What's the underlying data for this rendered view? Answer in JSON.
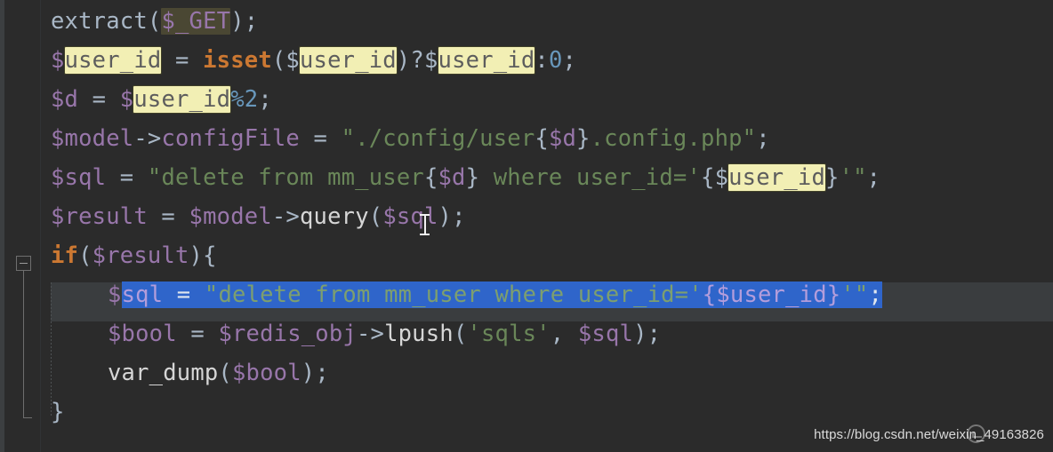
{
  "editor": {
    "background_color": "#2b2b2b",
    "gutter_color": "#3c3f41",
    "selection_color": "#2f65ca",
    "usage_highlight_color": "#f2efb4",
    "identifier_highlight_color": "#4a4733",
    "current_line_color": "#3a3d3f",
    "language": "PHP"
  },
  "code": {
    "lines": [
      {
        "index": 1,
        "text": "extract($_GET);",
        "tokens": [
          {
            "t": "extract",
            "k": "ident"
          },
          {
            "t": "(",
            "k": "punc"
          },
          {
            "t": "$_GET",
            "k": "var",
            "hl": "ident"
          },
          {
            "t": ")",
            "k": "punc"
          },
          {
            "t": ";",
            "k": "punc"
          }
        ]
      },
      {
        "index": 2,
        "text": "$user_id = isset($user_id)?$user_id:0;",
        "tokens": [
          {
            "t": "$",
            "k": "var"
          },
          {
            "t": "user_id",
            "k": "var",
            "hl": "write"
          },
          {
            "t": " = ",
            "k": "op"
          },
          {
            "t": "isset",
            "k": "kw"
          },
          {
            "t": "($",
            "k": "punc"
          },
          {
            "t": "user_id",
            "k": "var",
            "hl": "write"
          },
          {
            "t": ")?$",
            "k": "punc"
          },
          {
            "t": "user_id",
            "k": "var",
            "hl": "write"
          },
          {
            "t": ":",
            "k": "punc"
          },
          {
            "t": "0",
            "k": "num"
          },
          {
            "t": ";",
            "k": "punc"
          }
        ]
      },
      {
        "index": 3,
        "text": "$d = $user_id%2;",
        "tokens": [
          {
            "t": "$d",
            "k": "var"
          },
          {
            "t": " = ",
            "k": "op"
          },
          {
            "t": "$",
            "k": "var"
          },
          {
            "t": "user_id",
            "k": "var",
            "hl": "write"
          },
          {
            "t": "%",
            "k": "num"
          },
          {
            "t": "2",
            "k": "num"
          },
          {
            "t": ";",
            "k": "punc"
          }
        ]
      },
      {
        "index": 4,
        "text": "$model->configFile = \"./config/user{$d}.config.php\";",
        "tokens": [
          {
            "t": "$model",
            "k": "var"
          },
          {
            "t": "->",
            "k": "op"
          },
          {
            "t": "configFile",
            "k": "var"
          },
          {
            "t": " = ",
            "k": "op"
          },
          {
            "t": "\"./config/user",
            "k": "str"
          },
          {
            "t": "{",
            "k": "brace"
          },
          {
            "t": "$d",
            "k": "var"
          },
          {
            "t": "}",
            "k": "brace"
          },
          {
            "t": ".config.php\"",
            "k": "str"
          },
          {
            "t": ";",
            "k": "punc"
          }
        ]
      },
      {
        "index": 5,
        "text": "$sql = \"delete from mm_user{$d} where user_id='{$user_id}'\";",
        "tokens": [
          {
            "t": "$sql",
            "k": "var"
          },
          {
            "t": " = ",
            "k": "op"
          },
          {
            "t": "\"delete from mm_user",
            "k": "str"
          },
          {
            "t": "{",
            "k": "brace"
          },
          {
            "t": "$d",
            "k": "var"
          },
          {
            "t": "}",
            "k": "brace"
          },
          {
            "t": " where user_id='",
            "k": "str"
          },
          {
            "t": "{$",
            "k": "brace"
          },
          {
            "t": "user_id",
            "k": "var",
            "hl": "write"
          },
          {
            "t": "}",
            "k": "brace"
          },
          {
            "t": "'\"",
            "k": "str"
          },
          {
            "t": ";",
            "k": "punc"
          }
        ]
      },
      {
        "index": 6,
        "text": "$result = $model->query($sql);",
        "tokens": [
          {
            "t": "$result",
            "k": "var"
          },
          {
            "t": " = ",
            "k": "op"
          },
          {
            "t": "$model",
            "k": "var"
          },
          {
            "t": "->",
            "k": "op"
          },
          {
            "t": "query",
            "k": "fn"
          },
          {
            "t": "(",
            "k": "punc"
          },
          {
            "t": "$sql",
            "k": "var"
          },
          {
            "t": ")",
            "k": "punc"
          },
          {
            "t": ";",
            "k": "punc"
          }
        ]
      },
      {
        "index": 7,
        "text": "if($result){",
        "tokens": [
          {
            "t": "if",
            "k": "kw"
          },
          {
            "t": "(",
            "k": "punc"
          },
          {
            "t": "$result",
            "k": "var"
          },
          {
            "t": ")",
            "k": "punc"
          },
          {
            "t": "{",
            "k": "brace"
          }
        ]
      },
      {
        "index": 8,
        "text": "    $sql = \"delete from mm_user where user_id='{$user_id}'\";",
        "selected": true,
        "tokens": [
          {
            "t": "$",
            "k": "var"
          },
          {
            "t": "sql",
            "k": "var",
            "sel": true
          },
          {
            "t": " = ",
            "k": "op",
            "sel": true
          },
          {
            "t": "\"delete from mm_user where user_id='",
            "k": "str",
            "sel": true
          },
          {
            "t": "{$user_id}",
            "k": "var",
            "sel": true
          },
          {
            "t": "'\"",
            "k": "str",
            "sel": true
          },
          {
            "t": ";",
            "k": "punc",
            "sel": true
          }
        ]
      },
      {
        "index": 9,
        "text": "    $bool = $redis_obj->lpush('sqls', $sql);",
        "tokens": [
          {
            "t": "$bool",
            "k": "var"
          },
          {
            "t": " = ",
            "k": "op"
          },
          {
            "t": "$redis_obj",
            "k": "var"
          },
          {
            "t": "->",
            "k": "op"
          },
          {
            "t": "lpush",
            "k": "fn"
          },
          {
            "t": "(",
            "k": "punc"
          },
          {
            "t": "'sqls'",
            "k": "str"
          },
          {
            "t": ", ",
            "k": "punc"
          },
          {
            "t": "$sql",
            "k": "var"
          },
          {
            "t": ")",
            "k": "punc"
          },
          {
            "t": ";",
            "k": "punc"
          }
        ]
      },
      {
        "index": 10,
        "text": "    var_dump($bool);",
        "tokens": [
          {
            "t": "var_dump",
            "k": "fn"
          },
          {
            "t": "(",
            "k": "punc"
          },
          {
            "t": "$bool",
            "k": "var"
          },
          {
            "t": ")",
            "k": "punc"
          },
          {
            "t": ";",
            "k": "punc"
          }
        ]
      },
      {
        "index": 11,
        "text": "}",
        "tokens": [
          {
            "t": "}",
            "k": "brace"
          }
        ]
      }
    ]
  },
  "gutter": {
    "fold_marker_state": "expanded",
    "fold_marker_label": "-"
  },
  "watermark": {
    "url": "https://blog.csdn.net/weixin_49163826"
  }
}
